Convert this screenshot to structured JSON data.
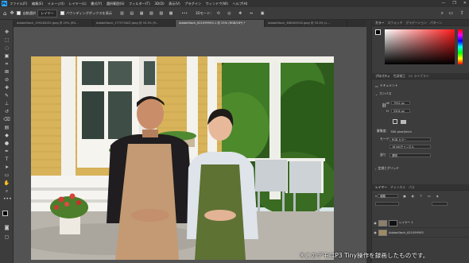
{
  "app": {
    "logo": "Ps",
    "menu": [
      "ファイル(F)",
      "編集(E)",
      "イメージ(I)",
      "レイヤー(L)",
      "書式(Y)",
      "選択範囲(S)",
      "フィルター(T)",
      "3D(D)",
      "表示(V)",
      "プラグイン",
      "ウィンドウ(W)",
      "ヘルプ(H)"
    ],
    "window_buttons": [
      "—",
      "❐",
      "✕"
    ]
  },
  "options_bar": {
    "auto_select_label": "自動選択",
    "auto_select_target": "レイヤー",
    "transform_controls_label": "バウンディングボックスを表示",
    "mode_3d_label": "3Dモード："
  },
  "tabs": [
    {
      "label": "AdobeStock_159248152.jpeg @ 25% (RG..."
    },
    {
      "label": "AdobeStock_177573402.jpeg @ 33.3% (R..."
    },
    {
      "label": "AdobeStock_621099593-1 @ 25% (RGB/16*) *"
    },
    {
      "label": "AdobeStock_368185518.jpeg @ 33.3% (L..."
    }
  ],
  "right_panel": {
    "color_tabs": [
      "カラー",
      "スウォッチ",
      "グラデーション",
      "パターン"
    ],
    "properties_tabs": [
      "プロパティ",
      "色調補正",
      "CC ライブラリ"
    ],
    "document_label": "ドキュメント",
    "canvas_header": "カンバス",
    "w_label": "W",
    "w_value": "7952 px",
    "h_label": "H",
    "h_value": "5304 px",
    "resolution_label": "解像度：",
    "resolution_value": "300 pixel/inch",
    "mode_label": "モード",
    "mode_value": "RGB カラー",
    "bits_value": "16 bit/チャンネル",
    "fill_label": "塗り",
    "fill_value": "透明",
    "rulers_header": "定規とグリッド",
    "layers_tabs": [
      "レイヤー",
      "チャンネル",
      "パス"
    ],
    "layers_kind": "種類",
    "layers": [
      {
        "name": "レイヤー 1"
      },
      {
        "name": "AdobeStock_621099593"
      }
    ]
  },
  "caption": "※このデモはP3 Tiny操作を録画したものです。",
  "colors": {
    "accent": "#31a8ff",
    "panel_bg": "#3c3c3c",
    "canvas_bg": "#535353"
  }
}
